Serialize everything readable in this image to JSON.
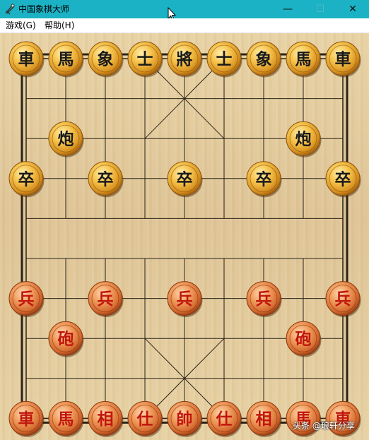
{
  "window": {
    "title": "中国象棋大师",
    "minimize_glyph": "—",
    "maximize_glyph": "☐",
    "close_glyph": "✕"
  },
  "menu": [
    {
      "label": "游戏(G)"
    },
    {
      "label": "帮助(H)"
    }
  ],
  "board": {
    "files": 9,
    "ranks": 10,
    "river_text": ""
  },
  "pieces": [
    {
      "side": "black",
      "char": "車",
      "file": 0,
      "rank": 0
    },
    {
      "side": "black",
      "char": "馬",
      "file": 1,
      "rank": 0
    },
    {
      "side": "black",
      "char": "象",
      "file": 2,
      "rank": 0
    },
    {
      "side": "black",
      "char": "士",
      "file": 3,
      "rank": 0
    },
    {
      "side": "black",
      "char": "將",
      "file": 4,
      "rank": 0
    },
    {
      "side": "black",
      "char": "士",
      "file": 5,
      "rank": 0
    },
    {
      "side": "black",
      "char": "象",
      "file": 6,
      "rank": 0
    },
    {
      "side": "black",
      "char": "馬",
      "file": 7,
      "rank": 0
    },
    {
      "side": "black",
      "char": "車",
      "file": 8,
      "rank": 0
    },
    {
      "side": "black",
      "char": "炮",
      "file": 1,
      "rank": 2
    },
    {
      "side": "black",
      "char": "炮",
      "file": 7,
      "rank": 2
    },
    {
      "side": "black",
      "char": "卒",
      "file": 0,
      "rank": 3
    },
    {
      "side": "black",
      "char": "卒",
      "file": 2,
      "rank": 3
    },
    {
      "side": "black",
      "char": "卒",
      "file": 4,
      "rank": 3
    },
    {
      "side": "black",
      "char": "卒",
      "file": 6,
      "rank": 3
    },
    {
      "side": "black",
      "char": "卒",
      "file": 8,
      "rank": 3
    },
    {
      "side": "red",
      "char": "兵",
      "file": 0,
      "rank": 6
    },
    {
      "side": "red",
      "char": "兵",
      "file": 2,
      "rank": 6
    },
    {
      "side": "red",
      "char": "兵",
      "file": 4,
      "rank": 6
    },
    {
      "side": "red",
      "char": "兵",
      "file": 6,
      "rank": 6
    },
    {
      "side": "red",
      "char": "兵",
      "file": 8,
      "rank": 6
    },
    {
      "side": "red",
      "char": "砲",
      "file": 1,
      "rank": 7
    },
    {
      "side": "red",
      "char": "砲",
      "file": 7,
      "rank": 7
    },
    {
      "side": "red",
      "char": "車",
      "file": 0,
      "rank": 9
    },
    {
      "side": "red",
      "char": "馬",
      "file": 1,
      "rank": 9
    },
    {
      "side": "red",
      "char": "相",
      "file": 2,
      "rank": 9
    },
    {
      "side": "red",
      "char": "仕",
      "file": 3,
      "rank": 9
    },
    {
      "side": "red",
      "char": "帥",
      "file": 4,
      "rank": 9
    },
    {
      "side": "red",
      "char": "仕",
      "file": 5,
      "rank": 9
    },
    {
      "side": "red",
      "char": "相",
      "file": 6,
      "rank": 9
    },
    {
      "side": "red",
      "char": "馬",
      "file": 7,
      "rank": 9
    },
    {
      "side": "red",
      "char": "車",
      "file": 8,
      "rank": 9
    }
  ],
  "colors": {
    "titlebar": "#1ab2c4",
    "line": "#2a2418",
    "piece_black_face": "#f0b53c",
    "piece_red_face": "#e9874a",
    "piece_black_text": "#1a1a1a",
    "piece_red_text": "#c0160e"
  },
  "watermark": "头条 @琅轩分享"
}
